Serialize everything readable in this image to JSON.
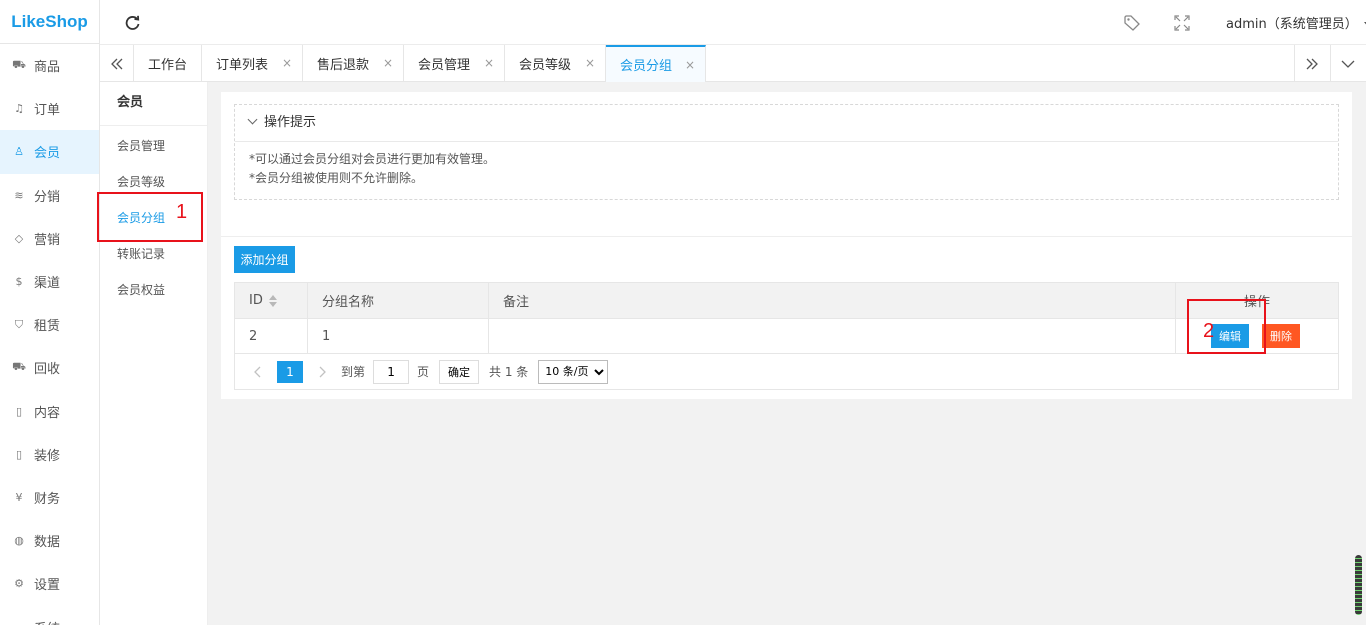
{
  "app": {
    "logo": "LikeShop"
  },
  "sidebar": {
    "items": [
      {
        "label": "商品",
        "icon": "cart-icon"
      },
      {
        "label": "订单",
        "icon": "bell-icon"
      },
      {
        "label": "会员",
        "icon": "user-icon",
        "active": true
      },
      {
        "label": "分销",
        "icon": "layers-icon"
      },
      {
        "label": "营销",
        "icon": "diamond-icon"
      },
      {
        "label": "渠道",
        "icon": "dollar-circle-icon"
      },
      {
        "label": "租赁",
        "icon": "shield-check-icon"
      },
      {
        "label": "回收",
        "icon": "cart-icon"
      },
      {
        "label": "内容",
        "icon": "book-icon"
      },
      {
        "label": "装修",
        "icon": "phone-icon"
      },
      {
        "label": "财务",
        "icon": "yen-circle-icon"
      },
      {
        "label": "数据",
        "icon": "globe-icon"
      },
      {
        "label": "设置",
        "icon": "gear-icon"
      },
      {
        "label": "系统",
        "icon": "chevron-icon"
      }
    ]
  },
  "header": {
    "user": "admin（系统管理员）"
  },
  "tabs": [
    {
      "label": "工作台",
      "closable": false
    },
    {
      "label": "订单列表",
      "closable": true
    },
    {
      "label": "售后退款",
      "closable": true
    },
    {
      "label": "会员管理",
      "closable": true
    },
    {
      "label": "会员等级",
      "closable": true
    },
    {
      "label": "会员分组",
      "closable": true,
      "active": true
    }
  ],
  "submenu": {
    "title": "会员",
    "items": [
      "会员管理",
      "会员等级",
      "会员分组",
      "转账记录",
      "会员权益"
    ],
    "active_index": 2
  },
  "tips": {
    "title": "操作提示",
    "lines": [
      "*可以通过会员分组对会员进行更加有效管理。",
      "*会员分组被使用则不允许删除。"
    ]
  },
  "toolbar": {
    "add_label": "添加分组"
  },
  "table": {
    "columns": [
      "ID",
      "分组名称",
      "备注",
      "操作"
    ],
    "rows": [
      {
        "id": "2",
        "name": "1",
        "remark": "",
        "edit": "编辑",
        "delete": "删除"
      }
    ]
  },
  "pagination": {
    "current": "1",
    "goto_label": "到第",
    "goto_value": "1",
    "page_label": "页",
    "confirm": "确定",
    "total": "共 1 条",
    "page_size": "10 条/页"
  },
  "annotations": {
    "one": "1",
    "two": "2",
    "color": "#e8121b"
  },
  "colors": {
    "accent": "#1a9be6",
    "danger": "#ff5722"
  }
}
